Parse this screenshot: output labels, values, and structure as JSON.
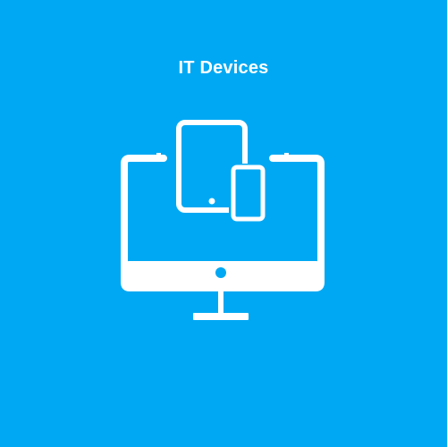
{
  "title": "IT Devices",
  "icon": "it-devices-icon",
  "colors": {
    "background": "#00A8F3",
    "foreground": "#FFFFFF"
  }
}
